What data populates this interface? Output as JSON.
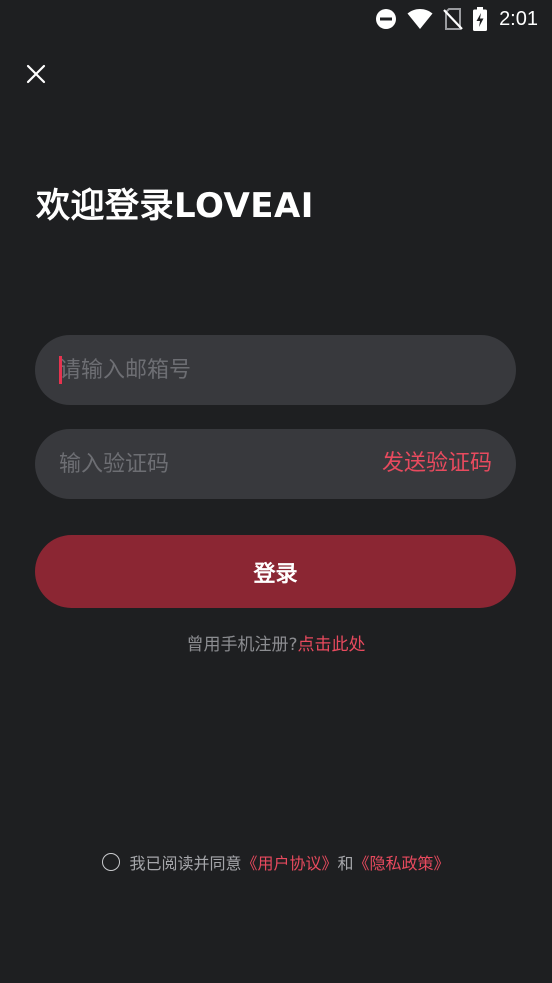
{
  "status_bar": {
    "time": "2:01",
    "icons": [
      "do-not-disturb-icon",
      "wifi-icon",
      "no-sim-icon",
      "battery-charging-icon"
    ]
  },
  "header": {
    "close_icon": "close-icon"
  },
  "title": "欢迎登录LOVEAI",
  "email": {
    "value": "",
    "placeholder": "请输入邮箱号"
  },
  "code": {
    "value": "",
    "placeholder": "输入验证码",
    "send_label": "发送验证码"
  },
  "login_label": "登录",
  "phone_prompt": {
    "text": "曾用手机注册?",
    "link": "点击此处"
  },
  "agreement": {
    "prefix": "我已阅读并同意",
    "user_agreement": "《用户协议》",
    "and": "和",
    "privacy_policy": "《隐私政策》"
  },
  "colors": {
    "background": "#1e1f21",
    "field": "#38393d",
    "accent": "#e84a5e",
    "button": "#8b2633"
  }
}
